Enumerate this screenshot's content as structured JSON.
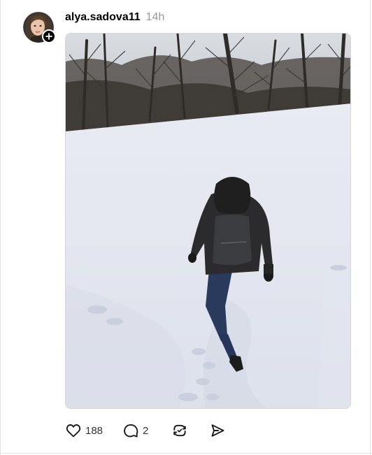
{
  "post": {
    "author": {
      "username": "alya.sadova11",
      "avatar_icon": "avatar-photo",
      "follow_icon": "plus-icon"
    },
    "timestamp": "14h",
    "image": {
      "description_icon": "post-photo"
    },
    "actions": {
      "like": {
        "icon": "heart-icon",
        "count": "188"
      },
      "comment": {
        "icon": "comment-icon",
        "count": "2"
      },
      "repost": {
        "icon": "repost-icon"
      },
      "share": {
        "icon": "share-icon"
      }
    }
  },
  "colors": {
    "text": "#000000",
    "muted": "#999999",
    "count": "#333333",
    "snow": "#e8eaf2",
    "sky": "#cfd3d9",
    "trees": "#3d3a37"
  }
}
